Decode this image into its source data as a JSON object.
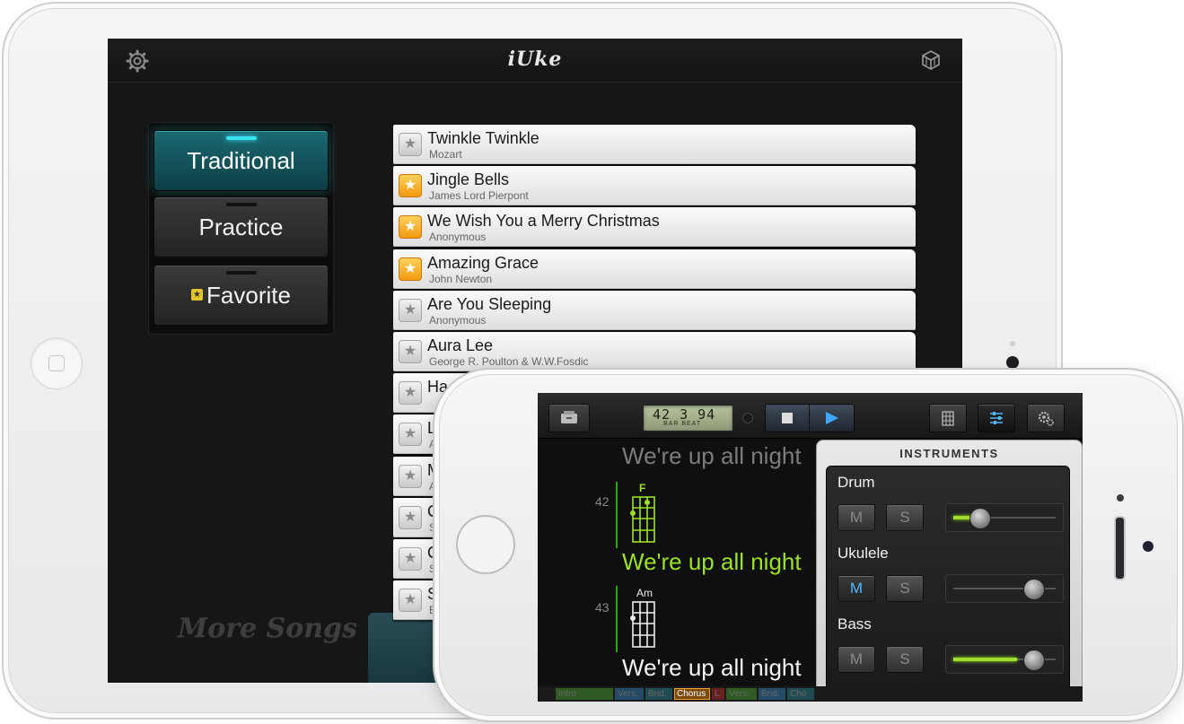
{
  "ipad": {
    "app_title": "iUke",
    "categories": [
      {
        "label": "Traditional",
        "active": true
      },
      {
        "label": "Practice",
        "active": false
      },
      {
        "label": "Favorite",
        "active": false
      }
    ],
    "more_songs": "More Songs",
    "songs": [
      {
        "title": "Twinkle Twinkle",
        "artist": "Mozart",
        "favorite": false
      },
      {
        "title": "Jingle Bells",
        "artist": "James Lord Pierpont",
        "favorite": true
      },
      {
        "title": "We Wish You a Merry Christmas",
        "artist": "Anonymous",
        "favorite": true
      },
      {
        "title": "Amazing Grace",
        "artist": "John Newton",
        "favorite": true
      },
      {
        "title": "Are You Sleeping",
        "artist": "Anonymous",
        "favorite": false
      },
      {
        "title": "Aura Lee",
        "artist": "George R. Poulton & W.W.Fosdic",
        "favorite": false
      },
      {
        "title": "Ha",
        "artist": "",
        "favorite": false
      },
      {
        "title": "L",
        "artist": "A",
        "favorite": false
      },
      {
        "title": "M",
        "artist": "A",
        "favorite": false
      },
      {
        "title": "C",
        "artist": "S",
        "favorite": false
      },
      {
        "title": "C",
        "artist": "S",
        "favorite": false
      },
      {
        "title": "S",
        "artist": "E",
        "favorite": false
      }
    ]
  },
  "iphone": {
    "lcd": {
      "value": "42 3 94",
      "sub": "BAR BEAT"
    },
    "lyrics": [
      {
        "text": "We're up all night",
        "state": "past"
      },
      {
        "text": "We're up all night",
        "state": "current",
        "bar": "42",
        "chord": "F"
      },
      {
        "text": "We're up all night",
        "state": "next",
        "bar": "43",
        "chord": "Am"
      }
    ],
    "instruments": {
      "header": "INSTRUMENTS",
      "tracks": [
        {
          "name": "Drum",
          "mute": "M",
          "solo": "S",
          "muted": false,
          "level": 0.25,
          "meter": 0.25
        },
        {
          "name": "Ukulele",
          "mute": "M",
          "solo": "S",
          "muted": true,
          "level": 0.78,
          "meter": 0
        },
        {
          "name": "Bass",
          "mute": "M",
          "solo": "S",
          "muted": false,
          "level": 0.78,
          "meter": 0.62
        }
      ]
    },
    "timeline": [
      {
        "label": "Intro",
        "color": "#2f5a23"
      },
      {
        "label": "Vers.",
        "color": "#234a66"
      },
      {
        "label": "Brid.",
        "color": "#1f4c52"
      },
      {
        "label": "Chorus",
        "color": "#7a4a10"
      },
      {
        "label": "L",
        "color": "#6a1f1f"
      },
      {
        "label": "Vers.",
        "color": "#2f5a23"
      },
      {
        "label": "Brid.",
        "color": "#234a66"
      },
      {
        "label": "Cho",
        "color": "#1f4c52"
      }
    ]
  }
}
